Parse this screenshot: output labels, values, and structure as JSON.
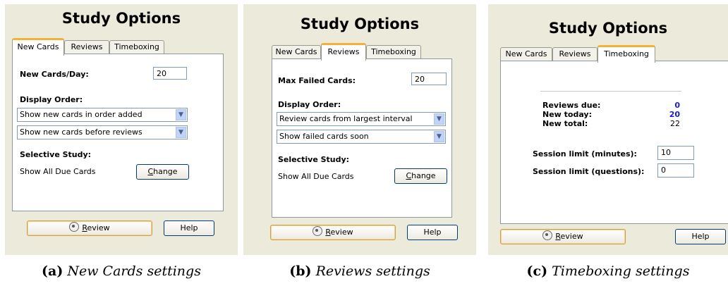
{
  "panels": [
    {
      "title": "Study Options",
      "tabs": [
        "New Cards",
        "Reviews",
        "Timeboxing"
      ],
      "field_label": "New Cards/Day:",
      "field_value": "20",
      "display_order_label": "Display Order:",
      "select1": "Show new cards in order added",
      "select2": "Show new cards before reviews",
      "selective_label": "Selective Study:",
      "selective_value": "Show All Due Cards",
      "change_label": "hange",
      "change_mnemonic": "C",
      "review_label": "eview",
      "review_mnemonic": "R",
      "help_label": "Help",
      "caption_letter": "(a)",
      "caption_text": "New Cards settings"
    },
    {
      "title": "Study Options",
      "tabs": [
        "New Cards",
        "Reviews",
        "Timeboxing"
      ],
      "field_label": "Max Failed Cards:",
      "field_value": "20",
      "display_order_label": "Display Order:",
      "select1": "Review cards from largest interval",
      "select2": "Show failed cards soon",
      "selective_label": "Selective Study:",
      "selective_value": "Show All Due Cards",
      "change_label": "hange",
      "change_mnemonic": "C",
      "review_label": "eview",
      "review_mnemonic": "R",
      "help_label": "Help",
      "caption_letter": "(b)",
      "caption_text": "Reviews settings"
    },
    {
      "title": "Study Options",
      "tabs": [
        "New Cards",
        "Reviews",
        "Timeboxing"
      ],
      "reviews_due_label": "Reviews due:",
      "reviews_due_value": "0",
      "new_today_label": "New today:",
      "new_today_value": "20",
      "new_total_label": "New total:",
      "new_total_value": "22",
      "session_minutes_label": "Session limit (minutes):",
      "session_minutes_value": "10",
      "session_questions_label": "Session limit (questions):",
      "session_questions_value": "0",
      "review_label": "eview",
      "review_mnemonic": "R",
      "help_label": "Help",
      "caption_letter": "(c)",
      "caption_text": "Timeboxing settings"
    }
  ],
  "colors": {
    "panel_bg": "#eceadb",
    "active_tab_accent": "#f5b134",
    "stat_blue": "#1a1ad0"
  }
}
